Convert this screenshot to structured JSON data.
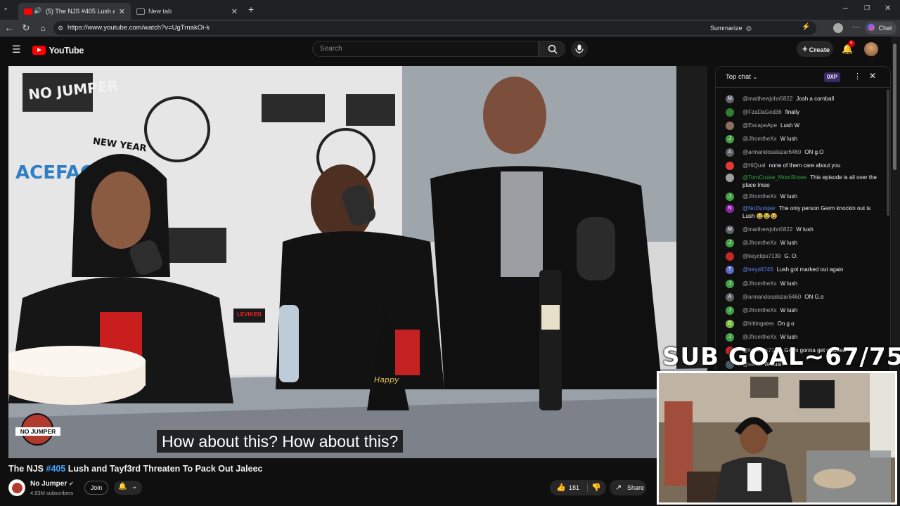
{
  "browser": {
    "tabs": [
      {
        "label": "(5) The NJS #405 Lush and Ta",
        "active": true
      },
      {
        "label": "New tab",
        "active": false
      }
    ],
    "url": "https://www.youtube.com/watch?v=UgTrnakOi-k",
    "summarize_label": "Summarize",
    "chat_label": "Chat"
  },
  "youtube": {
    "logo_text": "YouTube",
    "search_placeholder": "Search",
    "create_label": "Create",
    "notification_count": "5"
  },
  "video": {
    "caption": "How about this? How about this?",
    "watermark_top": "NO JUMPER",
    "watermark_corner": "NO JUMPER",
    "mic_label": "LEVIKEN"
  },
  "chat": {
    "mode_label": "Top chat",
    "points_label": "0XP",
    "messages": [
      {
        "author": "@matthewjohn5822",
        "text": "Josh a cornball",
        "avatar": "M",
        "avatar_color": "#5f6368"
      },
      {
        "author": "@FzaDaGod36",
        "text": "finally",
        "avatar": "",
        "avatar_color": "#2e7d32"
      },
      {
        "author": "@EscapeApe",
        "text": "Lush W",
        "avatar": "",
        "avatar_color": "#8d6e63"
      },
      {
        "author": "@JfromtheXx",
        "text": "W lush",
        "avatar": "J",
        "avatar_color": "#43a047"
      },
      {
        "author": "@armandosalazar6460",
        "text": "ON g.O",
        "avatar": "A",
        "avatar_color": "#5f6368"
      },
      {
        "author": "@HiQual",
        "text": "none of them care about you",
        "avatar": "",
        "avatar_color": "#e53935"
      },
      {
        "author": "@TomCruise_MomShoes",
        "text": "This episode is all over the place lmao",
        "avatar": "",
        "avatar_color": "#9e9e9e",
        "author_color": "#2ba640"
      },
      {
        "author": "@JfromtheXx",
        "text": "W lush",
        "avatar": "J",
        "avatar_color": "#43a047"
      },
      {
        "author": "@NoDumper",
        "text": "The only person Germ knockin out is Lush 😂😂😂",
        "avatar": "N",
        "avatar_color": "#8e24aa",
        "author_color": "#5e84f1"
      },
      {
        "author": "@matthewjohn5822",
        "text": "W lush",
        "avatar": "M",
        "avatar_color": "#5f6368"
      },
      {
        "author": "@JfromtheXx",
        "text": "W lush",
        "avatar": "J",
        "avatar_color": "#43a047"
      },
      {
        "author": "@keyclips7139",
        "text": "G. O.",
        "avatar": "",
        "avatar_color": "#c62828"
      },
      {
        "author": "@treyd4745",
        "text": "Lush got marked out again",
        "avatar": "T",
        "avatar_color": "#5c6bc0",
        "author_color": "#5e84f1"
      },
      {
        "author": "@JfromtheXx",
        "text": "W lush",
        "avatar": "J",
        "avatar_color": "#43a047"
      },
      {
        "author": "@armandosalazar6460",
        "text": "ON G.o",
        "avatar": "A",
        "avatar_color": "#5f6368"
      },
      {
        "author": "@JfromtheXx",
        "text": "W lush",
        "avatar": "J",
        "avatar_color": "#43a047"
      },
      {
        "author": "@hittingates",
        "text": "On g o",
        "avatar": "G",
        "avatar_color": "#7cb342"
      },
      {
        "author": "@JfromtheXx",
        "text": "W lush",
        "avatar": "J",
        "avatar_color": "#43a047"
      },
      {
        "author": "@keyclips7139",
        "text": "Germ gonna get washed",
        "avatar": "",
        "avatar_color": "#c62828"
      },
      {
        "author": "@seraf",
        "text": "W Lush",
        "avatar": "",
        "avatar_color": "#455a64"
      }
    ]
  },
  "overlay": {
    "sub_goal": "SUB GOAL~67/75"
  },
  "below_video": {
    "title_prefix": "The NJS ",
    "title_tag": "#405",
    "title_rest": " Lush and Tayf3rd Threaten To Pack Out Jaleec",
    "channel_name": "No Jumper",
    "subscribers": "4.93M subscribers",
    "join_label": "Join",
    "like_count": "181",
    "share_label": "Share"
  }
}
